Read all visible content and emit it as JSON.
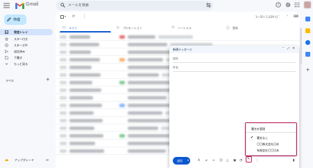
{
  "app": {
    "brand": "Gmail"
  },
  "search": {
    "placeholder": "メールを検索"
  },
  "compose_button": {
    "label": "作成"
  },
  "sidebar": {
    "items": [
      {
        "label": "受信トレイ",
        "icon": "inbox-icon",
        "active": true
      },
      {
        "label": "スター付き",
        "icon": "star-icon",
        "active": false
      },
      {
        "label": "スヌーズ中",
        "icon": "clock-icon",
        "active": false
      },
      {
        "label": "送信済み",
        "icon": "send-icon",
        "active": false
      },
      {
        "label": "下書き",
        "icon": "draft-icon",
        "active": false
      },
      {
        "label": "もっと見る",
        "icon": "chevron-down-icon",
        "active": false
      }
    ],
    "labels_title": "ラベル",
    "labels_add": "+",
    "upgrade_label": "アップグレード"
  },
  "toolbar": {
    "refresh_icon": "refresh-icon",
    "more_icon": "more-vert-icon",
    "pager_text": "1～50 / 1,639 行",
    "prev": "‹",
    "next": "›"
  },
  "tabs": [
    {
      "label": "メイン",
      "icon": "inbox-icon",
      "active": true
    },
    {
      "label": "プロモーション",
      "icon": "tag-icon",
      "active": false
    },
    {
      "label": "ソーシャル",
      "icon": "people-icon",
      "active": false
    },
    {
      "label": "更新",
      "icon": "info-icon",
      "active": false
    }
  ],
  "compose_window": {
    "title": "新規メッセージ",
    "to_label": "宛先",
    "subject_label": "件名",
    "send_label": "送信"
  },
  "signature_menu": {
    "items": [
      {
        "label": "署名を管理",
        "checked": false
      },
      {
        "label": "署名なし",
        "checked": true
      },
      {
        "label": "〇〇株式会社日本",
        "checked": false
      },
      {
        "label": "有限会社〇〇日本",
        "checked": false
      }
    ]
  },
  "colors": {
    "accent": "#0b57d0",
    "highlight": "#c2185b",
    "compose_bg": "#c2e7ff",
    "active_nav": "#d3e3fd"
  }
}
